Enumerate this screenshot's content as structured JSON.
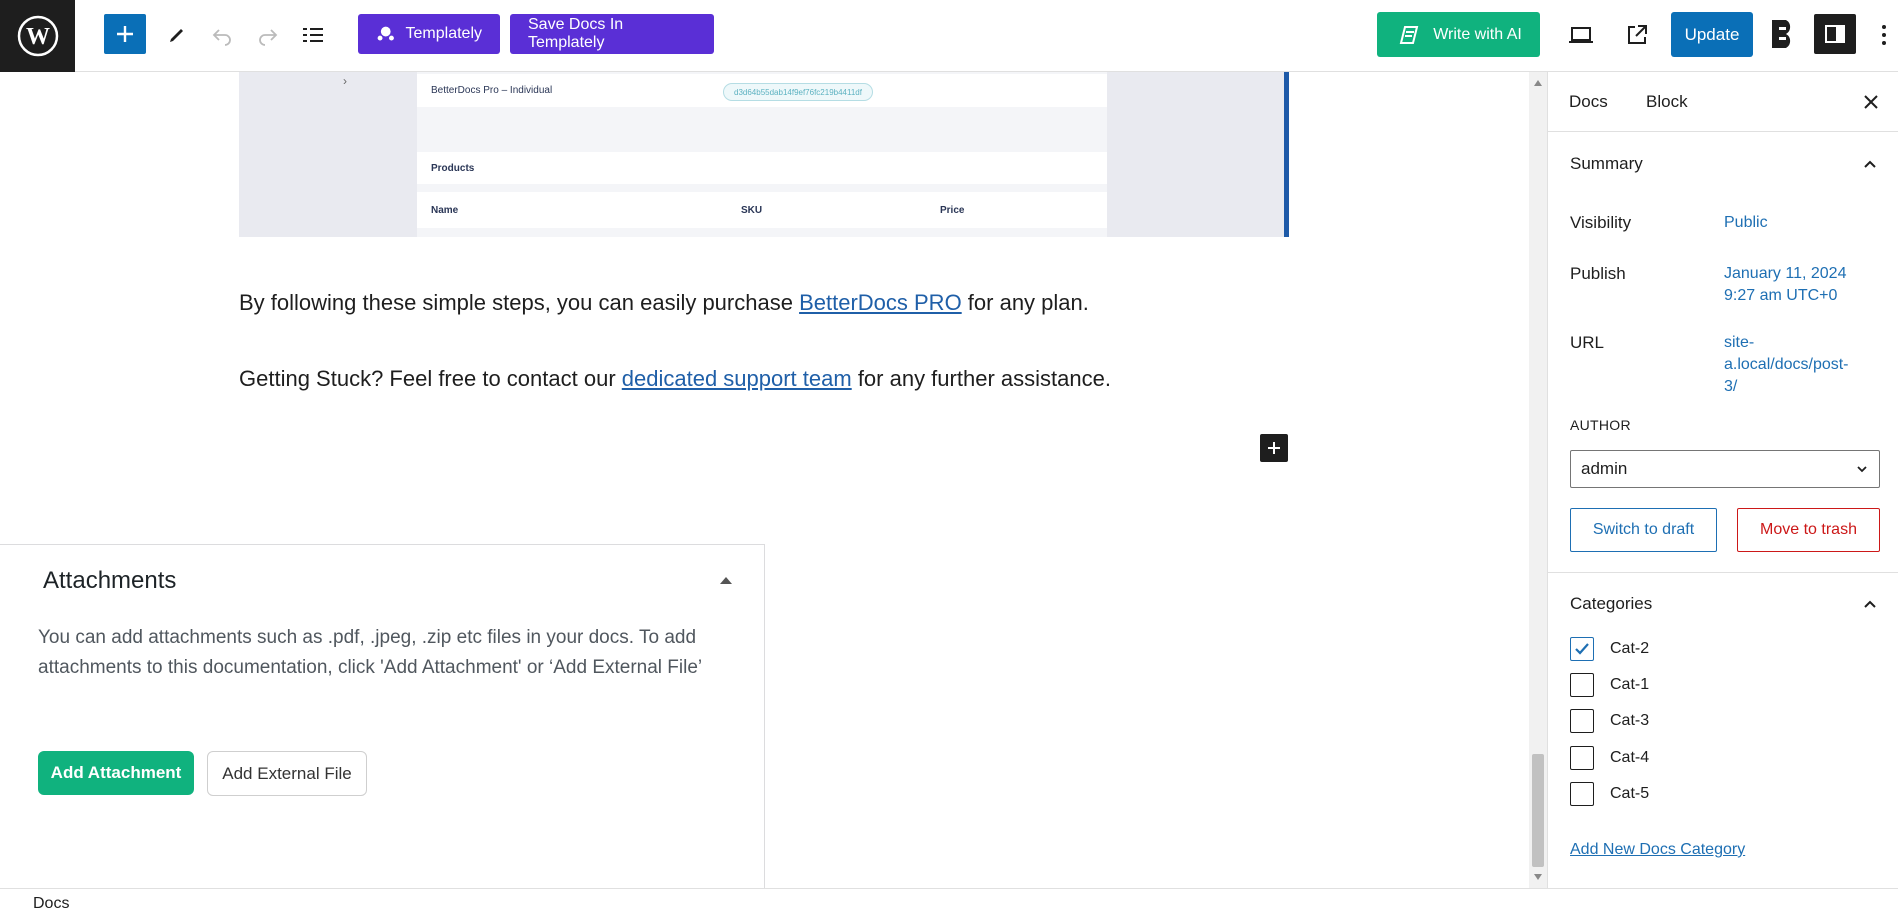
{
  "toolbar": {
    "templately_label": "Templately",
    "save_docs_label": "Save Docs In Templately",
    "write_ai_label": "Write with AI",
    "update_label": "Update"
  },
  "screenshot_preview": {
    "row1_left": "BetterDocs Pro – Individual",
    "row1_key": "d3d64b55dab14f9ef76fc219b4411df",
    "products_label": "Products",
    "col_name": "Name",
    "col_sku": "SKU",
    "col_price": "Price"
  },
  "content": {
    "para1_before": "By following these simple steps, you can easily purchase ",
    "para1_link": "BetterDocs PRO",
    "para1_after": " for any plan.",
    "para2_before": "Getting Stuck? Feel free to contact our ",
    "para2_link": "dedicated support team",
    "para2_after": " for any further assistance."
  },
  "attachments": {
    "title": "Attachments",
    "description": "You can add attachments such as .pdf, .jpeg, .zip etc files in your docs. To add attachments to this documentation, click 'Add Attachment' or ‘Add External File’",
    "add_attachment_label": "Add Attachment",
    "add_external_label": "Add External File"
  },
  "sidebar": {
    "tabs": [
      {
        "label": "Docs",
        "active": true
      },
      {
        "label": "Block",
        "active": false
      }
    ],
    "summary": {
      "title": "Summary",
      "visibility_label": "Visibility",
      "visibility_value": "Public",
      "publish_label": "Publish",
      "publish_date": "January 11, 2024",
      "publish_time": "9:27 am UTC+0",
      "url_label": "URL",
      "url_line1": "site-",
      "url_line2": "a.local/docs/post-",
      "url_line3": "3/",
      "author_label": "AUTHOR",
      "author_value": "admin",
      "switch_draft_label": "Switch to draft",
      "move_trash_label": "Move to trash"
    },
    "categories": {
      "title": "Categories",
      "items": [
        {
          "label": "Cat-2",
          "checked": true
        },
        {
          "label": "Cat-1",
          "checked": false
        },
        {
          "label": "Cat-3",
          "checked": false
        },
        {
          "label": "Cat-4",
          "checked": false
        },
        {
          "label": "Cat-5",
          "checked": false
        }
      ],
      "add_new_label": "Add New Docs Category"
    }
  },
  "footer": {
    "breadcrumb": "Docs"
  },
  "colors": {
    "wp_blue": "#0a6fb7",
    "templately_purple": "#5a2fd6",
    "ai_green": "#10b27e",
    "link_blue": "#1e6fb3",
    "danger_red": "#cc1818"
  }
}
